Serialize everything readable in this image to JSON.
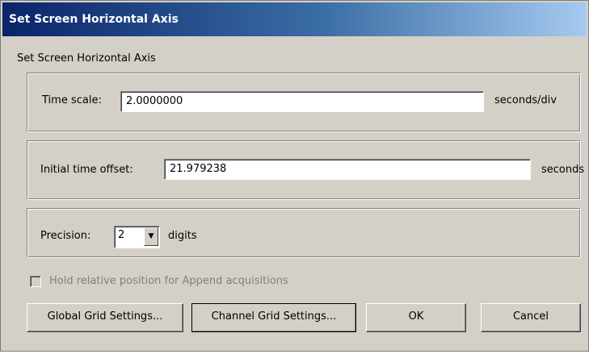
{
  "window": {
    "title": "Set Screen Horizontal Axis"
  },
  "caption": "Set Screen Horizontal Axis",
  "time_scale": {
    "label": "Time scale:",
    "value": "2.0000000",
    "unit": "seconds/div"
  },
  "initial_offset": {
    "label": "Initial time offset:",
    "value": "21.979238",
    "unit": "seconds"
  },
  "precision": {
    "label": "Precision:",
    "value": "2",
    "unit": "digits"
  },
  "hold_checkbox": {
    "label": "Hold relative position for Append acquisitions",
    "checked": false,
    "enabled": false
  },
  "buttons": {
    "global": "Global Grid Settings...",
    "channel": "Channel Grid Settings...",
    "ok": "OK",
    "cancel": "Cancel"
  },
  "icons": {
    "combo_arrow": "chevron-down-icon"
  }
}
